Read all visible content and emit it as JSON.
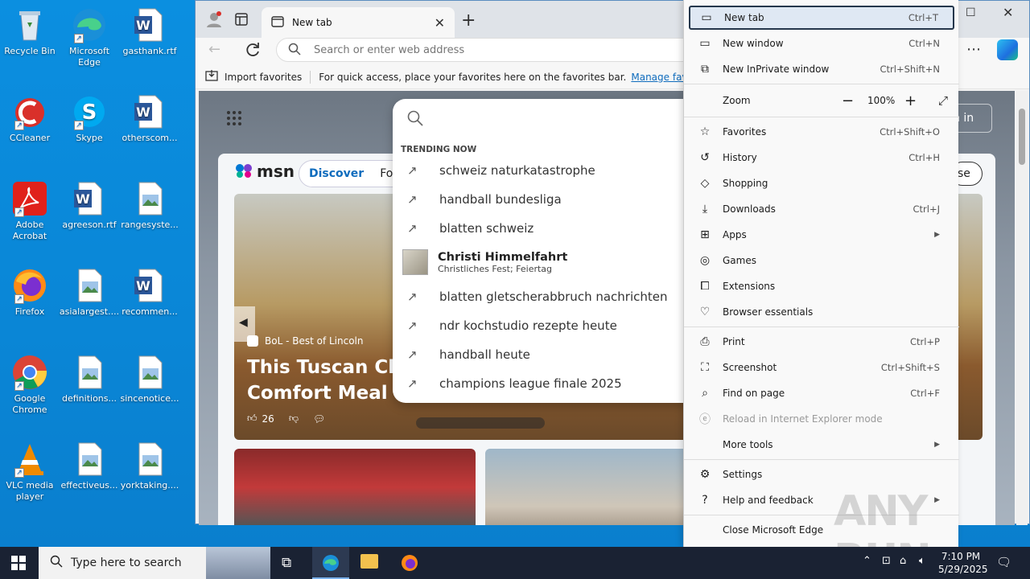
{
  "desktop": {
    "icons": [
      {
        "label": "Recycle Bin"
      },
      {
        "label": "Microsoft Edge"
      },
      {
        "label": "gasthank.rtf"
      },
      {
        "label": "CCleaner"
      },
      {
        "label": "Skype"
      },
      {
        "label": "otherscom..."
      },
      {
        "label": "Adobe Acrobat"
      },
      {
        "label": "agreeson.rtf"
      },
      {
        "label": "rangesyste..."
      },
      {
        "label": "Firefox"
      },
      {
        "label": "asialargest...."
      },
      {
        "label": "recommen..."
      },
      {
        "label": "Google Chrome"
      },
      {
        "label": "definitions..."
      },
      {
        "label": "sincenotice..."
      },
      {
        "label": "VLC media player"
      },
      {
        "label": "effectiveus..."
      },
      {
        "label": "yorktaking...."
      }
    ]
  },
  "browser": {
    "tab_title": "New tab",
    "address_placeholder": "Search or enter web address",
    "favbar": {
      "import_label": "Import favorites",
      "message": "For quick access, place your favorites here on the favorites bar.",
      "manage_link": "Manage favorites now"
    },
    "signin_label": "n in",
    "close_label": "se"
  },
  "msn": {
    "logo": "msn",
    "tab_discover": "Discover",
    "tab_following": "Follo",
    "hero_source": "BoL - Best of Lincoln",
    "hero_title_line1": "This Tuscan Chick",
    "hero_title_line2": "Comfort Meal",
    "likes": "26"
  },
  "search_dropdown": {
    "trending_label": "TRENDING NOW",
    "items": [
      {
        "text": "schweiz naturkatastrophe"
      },
      {
        "text": "handball bundesliga"
      },
      {
        "text": "blatten schweiz"
      },
      {
        "text": "Christi Himmelfahrt",
        "sub": "Christliches Fest; Feiertag"
      },
      {
        "text": "blatten gletscherabbruch nachrichten"
      },
      {
        "text": "ndr kochstudio rezepte heute"
      },
      {
        "text": "handball heute"
      },
      {
        "text": "champions league finale 2025"
      }
    ]
  },
  "menu": {
    "new_tab": {
      "label": "New tab",
      "shortcut": "Ctrl+T"
    },
    "new_window": {
      "label": "New window",
      "shortcut": "Ctrl+N"
    },
    "new_inprivate": {
      "label": "New InPrivate window",
      "shortcut": "Ctrl+Shift+N"
    },
    "zoom": {
      "label": "Zoom",
      "value": "100%"
    },
    "favorites": {
      "label": "Favorites",
      "shortcut": "Ctrl+Shift+O"
    },
    "history": {
      "label": "History",
      "shortcut": "Ctrl+H"
    },
    "shopping": {
      "label": "Shopping"
    },
    "downloads": {
      "label": "Downloads",
      "shortcut": "Ctrl+J"
    },
    "apps": {
      "label": "Apps"
    },
    "games": {
      "label": "Games"
    },
    "extensions": {
      "label": "Extensions"
    },
    "browser_essentials": {
      "label": "Browser essentials"
    },
    "print": {
      "label": "Print",
      "shortcut": "Ctrl+P"
    },
    "screenshot": {
      "label": "Screenshot",
      "shortcut": "Ctrl+Shift+S"
    },
    "find_on_page": {
      "label": "Find on page",
      "shortcut": "Ctrl+F"
    },
    "reload_ie": {
      "label": "Reload in Internet Explorer mode"
    },
    "more_tools": {
      "label": "More tools"
    },
    "settings": {
      "label": "Settings"
    },
    "help_feedback": {
      "label": "Help and feedback"
    },
    "close_edge": {
      "label": "Close Microsoft Edge"
    }
  },
  "taskbar": {
    "search_placeholder": "Type here to search",
    "time": "7:10 PM",
    "date": "5/29/2025"
  },
  "watermark": "ANY RUN",
  "colors": {
    "desktop_bg": "#0a8ad8",
    "taskbar_bg": "#1a2233",
    "menu_selected": "#dfe8f3",
    "edge_link": "#0f6cbd"
  }
}
